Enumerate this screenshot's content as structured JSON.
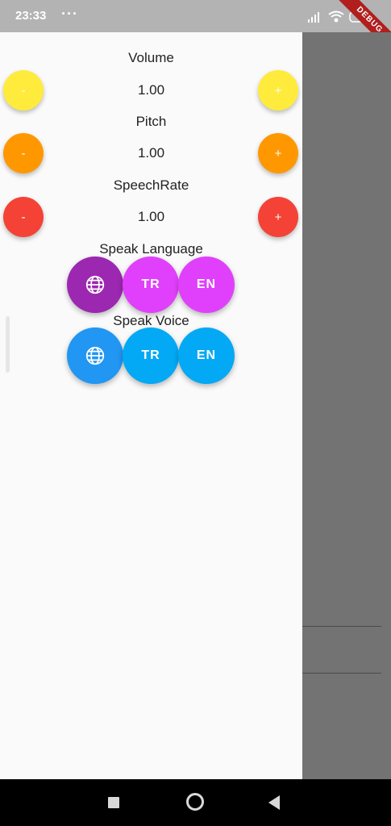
{
  "status_bar": {
    "time": "23:33",
    "dots": "···",
    "debug_label": "DEBUG"
  },
  "volume": {
    "label": "Volume",
    "value": "1.00",
    "minus": "-",
    "plus": "+",
    "color": "#ffeb3b"
  },
  "pitch": {
    "label": "Pitch",
    "value": "1.00",
    "minus": "-",
    "plus": "+",
    "color": "#ff9800"
  },
  "speech_rate": {
    "label": "SpeechRate",
    "value": "1.00",
    "minus": "-",
    "plus": "+",
    "color": "#f44336"
  },
  "speak_language": {
    "label": "Speak Language",
    "globe_icon": "globe-icon",
    "tr": "TR",
    "en": "EN",
    "globe_color": "#9c27b0",
    "button_color": "#e040fb"
  },
  "speak_voice": {
    "label": "Speak Voice",
    "globe_icon": "globe-icon",
    "tr": "TR",
    "en": "EN",
    "globe_color": "#2196f3",
    "button_color": "#03a9f4"
  }
}
